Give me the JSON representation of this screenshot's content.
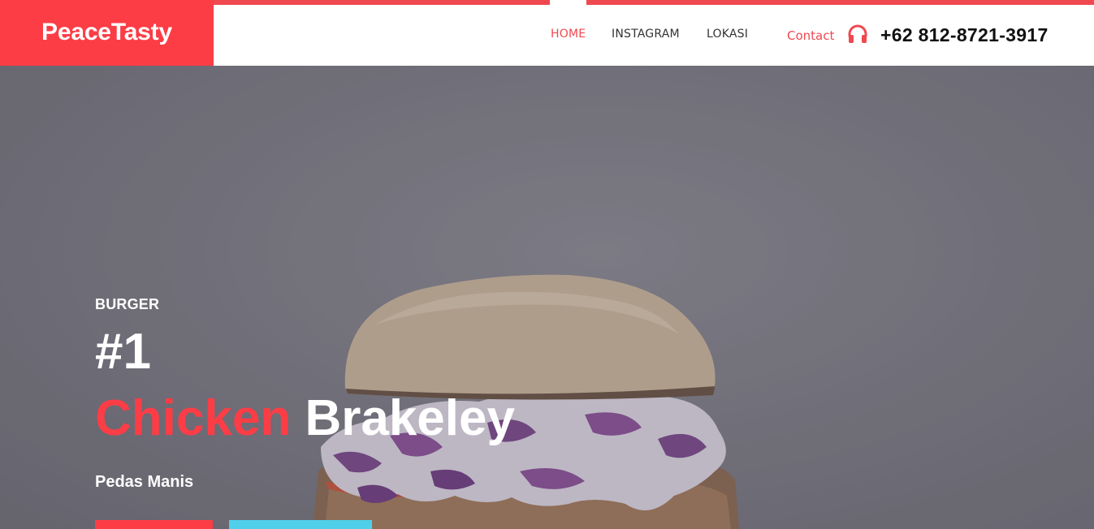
{
  "brand": {
    "name": "PeaceTasty",
    "accent_color": "#fc3d46"
  },
  "nav": {
    "items": [
      {
        "label": "HOME",
        "active": true
      },
      {
        "label": "INSTAGRAM",
        "active": false
      },
      {
        "label": "LOKASI",
        "active": false
      }
    ]
  },
  "contact": {
    "label": "Contact",
    "icon": "headphone-icon",
    "phone": "+62 812-8721-3917"
  },
  "hero": {
    "category": "BURGER",
    "rank": "#1",
    "title_red": "Chicken",
    "title_white": "Brakeley",
    "subtitle": "Pedas Manis",
    "buttons": [
      {
        "label": "",
        "color": "#fc3d46"
      },
      {
        "label": "",
        "color": "#4fcfea"
      }
    ]
  }
}
